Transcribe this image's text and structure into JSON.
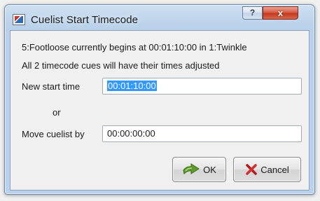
{
  "window": {
    "title": "Cuelist Start Timecode",
    "help_label": "?",
    "close_label": "x"
  },
  "message": {
    "line1": "5:Footloose currently begins at 00:01:10:00 in 1:Twinkle",
    "line2": "All 2 timecode cues will have their times adjusted"
  },
  "form": {
    "new_start_label": "New start time",
    "new_start_value": "00:01:10:00",
    "or_label": "or",
    "move_label": "Move cuelist by",
    "move_value": "00:00:00:00"
  },
  "buttons": {
    "ok_label": "OK",
    "cancel_label": "Cancel"
  },
  "icons": {
    "app": "cuelist-app-icon",
    "ok": "green-arrow-check-icon",
    "cancel": "red-x-icon"
  }
}
